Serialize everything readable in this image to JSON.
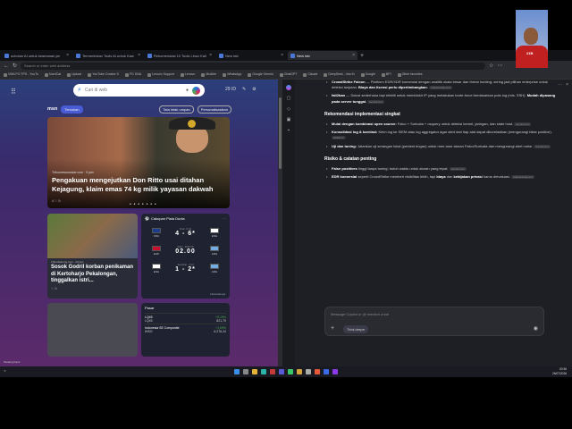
{
  "tabs": [
    {
      "label": "ucbolan AI untuk keamanan jar"
    },
    {
      "label": "Termeninkan Tools AI untuk Kaw"
    },
    {
      "label": "Rekomendasi 10 Tools Linux Kali"
    },
    {
      "label": "New tab"
    },
    {
      "label": "New tab"
    }
  ],
  "address": {
    "placeholder": "Search or enter web address"
  },
  "bookmarks": [
    "VMA PO TPS - YouTu",
    "NordCat",
    "Upload",
    "YouTube Creator S",
    "FG DNA",
    "Lenovo Support",
    "Lenovo",
    "McAfee",
    "WhatsApp",
    "Google Gemini",
    "ChatGPT",
    "Claude",
    "DeepSeek - Into th",
    "Google",
    "BPI",
    "Other favorites"
  ],
  "newtab": {
    "search_placeholder": "Cari di web",
    "weather": "29 ID",
    "msn": "msn",
    "pills": [
      "Temukan",
      "Tata letak umpan",
      "Personalisasikan"
    ],
    "hero": {
      "source": "Tribunnewsmaker.com · 9 jam",
      "title": "Pengakuan mengejutkan Don Ritto usai ditahan Kejagung, klaim emas 74 kg milik yayasan dakwah",
      "reactions": "4  ♡  ↻"
    },
    "card1": {
      "source": "Tribunlatenng.com · 23 jam",
      "title": "Sosok Godril korban penikaman di Kertoharjo Pekalongan, tinggalkan istri...",
      "reactions": "♡  ↻"
    },
    "sport": {
      "title": "Cakupan Piala Dunia",
      "link": "Lihat lainnya",
      "matches": [
        {
          "home": "FRA",
          "away": "ENG",
          "score": "4 - 6*",
          "status": "Final · 8 Jul",
          "home_color": "#1b3c8a",
          "away_color": "#ffffff"
        },
        {
          "home": "ESP",
          "away": "ARG",
          "score": "02.00",
          "status": "Rabu · 2026 VS",
          "home_color": "#c8102e",
          "away_color": "#74acdf"
        },
        {
          "home": "ENG",
          "away": "ARG",
          "score": "1 - 2*",
          "status": "Semifinal · 3 Jul",
          "home_color": "#ffffff",
          "away_color": "#74acdf"
        }
      ]
    },
    "market": {
      "title": "Pasar",
      "rows": [
        {
          "name": "LQ45",
          "sub": "LQ45",
          "change": "+2,19%",
          "value": "821,79"
        },
        {
          "name": "Indonesia SE Composite",
          "sub": "IHSG",
          "change": "+1,05%",
          "value": "6.276,24"
        }
      ]
    },
    "feedback": "Tautang Kami"
  },
  "copilot": {
    "bullets_top": [
      {
        "bold": "CrowdStrike Falcon",
        "text": " — Platform EDR/XDR komersial dengan analitik skala besar dan threat hunting; sering jadi pilihan enterprise untuk deteksi lanjutan. ",
        "bold2": "Biaya dan lisensi perlu dipertimbangkan.",
        "tag": "cybersecurity.com"
      },
      {
        "bold": "fail2ban",
        "text": " — Solusi sederhana tapi efektif untuk memblokir IP yang melakukan brute-force berdasarkan pola log (mis. SSH). ",
        "bold2": "Mudah dipasang pada server tunggal.",
        "tag": "tecmint.com"
      }
    ],
    "heading1": "Rekomendasi implementasi singkat",
    "impl": [
      {
        "bold": "Mulai dengan kombinasi open source:",
        "text": " Falco + Suricata + osquery untuk deteksi kernel, jaringan, dan state host.",
        "tag": "tecmint.com"
      },
      {
        "bold": "Konsolidasi log & korelasi:",
        "text": " Kirim log ke SIEM atau log aggregator agar alert dari tiap alat dapat dikorelasikan (mengurangi false positive).",
        "tag": "elastic.co"
      },
      {
        "bold": "Uji dan tuning:",
        "text": " Jalankan uji serangan lokal (pentest ringan) untuk men-tune aturan Falco/Suricata dan mengurangi alert noise.",
        "tag": "tecmint.com"
      }
    ],
    "heading2": "Risiko & catatan penting",
    "risk": [
      {
        "bold": "False positives",
        "text": " tinggi tanpa tuning; butuh waktu untuk aturan yang tepat.",
        "tag": "tecmint.com"
      },
      {
        "bold": "EDR komersial",
        "text": " seperti CrowdStrike memberi visibilitas lebih, tapi ",
        "bold2": "biaya",
        "text2": " dan ",
        "bold3": "kebijakan privasi",
        "text3": " harus dievaluasi.",
        "tag": "cybersecurity.com"
      }
    ],
    "compose_placeholder": "Message Copilot or @ mention a tab",
    "think": "Think deeper"
  },
  "webcam": {
    "logo": "21B"
  },
  "clock": {
    "time": "00.56",
    "date": "26/07/2026"
  }
}
